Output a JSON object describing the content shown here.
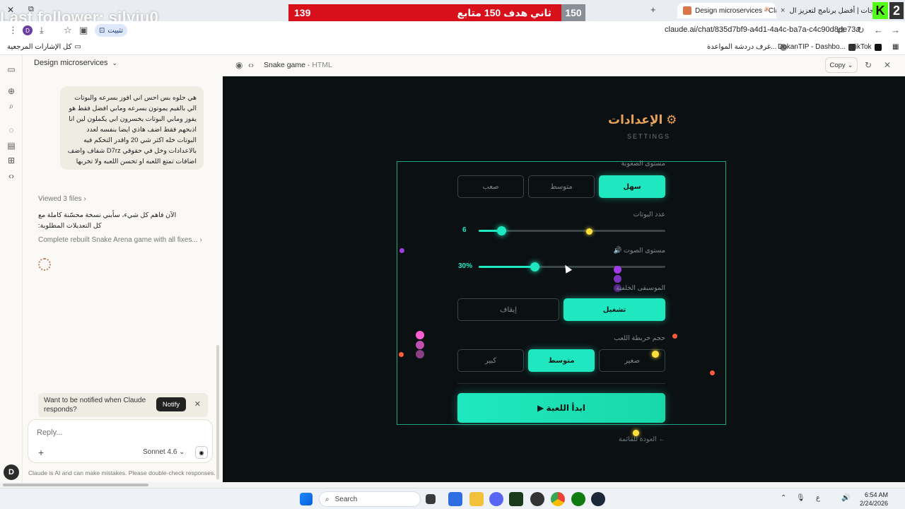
{
  "browser": {
    "tabs": [
      {
        "label": "Design microservices - Clau",
        "active": true
      },
      {
        "label": "الويدجات | أفضل برنامج لتعزيز ال",
        "active": false
      }
    ],
    "url": "claude.ai/chat/835d7bf9-a4d1-4a4c-ba7a-c4c90d8de73a",
    "install_label": "تثبيت",
    "profile_initial": "D",
    "bookmarks": {
      "all_bookmarks": "كل الإشارات المرجعية",
      "item_1": "غرف دردشة المواعدة...",
      "item_2": "DokanTIP - Dashbo...",
      "item_3": "TikTok"
    }
  },
  "overlay": {
    "follower_text": "Last follower: silviu0",
    "goal_current": "139",
    "goal_text": "ثاني هدف 150 متابع",
    "goal_target": "150",
    "kick_count": "2"
  },
  "claude": {
    "chat_title": "Design microservices",
    "user_message": "هي حلوه بس احس اني افوز بسرعه والبوتات الي بالقيم يموتون بسرعه ومابي افضل فقط هو يفوز ومابي البوتات يخسرون ابي يكملون لين انا اذبحهم فقط اضف هاذي ايضا بنفسه لعدد البوتات خله اكثر شي 20 واقدر التحكم فيه بالاعدادات وخل في حقوقي D7rz شفاف واضف اضافات تمتع اللعبه او تحسن اللعبه ولا تخربها",
    "viewed_files": "Viewed 3 files",
    "assistant_message": "الآن فاهم كل شيء، سأبني نسخة محسّنة كاملة مع كل التعديلات المطلوبة:",
    "artifact_link": "Complete rebuilt Snake Arena game with all fixes...",
    "notify_text": "Want to be notified when Claude responds?",
    "notify_button": "Notify",
    "reply_placeholder": "Reply...",
    "model": "Sonnet 4.6",
    "disclaimer": "Claude is AI and can make mistakes. Please double-check responses.",
    "user_initial": "D"
  },
  "artifact": {
    "title": "Snake game",
    "type": "HTML",
    "copy_label": "Copy"
  },
  "game": {
    "settings_title": "⚙ الإعدادات",
    "settings_subtitle": "SETTINGS",
    "difficulty": {
      "label": "مستوى الصعوبة",
      "options": [
        "سهل",
        "متوسط",
        "صعب"
      ],
      "selected": "سهل"
    },
    "bots": {
      "label": "عدد البوتات",
      "value": "6",
      "fraction": 0.12
    },
    "volume": {
      "label": "مستوى الصوت 🔊",
      "value": "30%",
      "fraction": 0.3
    },
    "music": {
      "label": "الموسيقى الخلفية",
      "options": [
        "تشغيل",
        "إيقاف"
      ],
      "selected": "تشغيل"
    },
    "map_size": {
      "label": "حجم خريطة اللعب",
      "options": [
        "صغير",
        "متوسط",
        "كبير"
      ],
      "selected": "متوسط"
    },
    "start_button": "ابدأ اللعبة ▶",
    "back_link": "← العودة للقائمة",
    "accent": "#1fe8c0"
  },
  "taskbar": {
    "search": "Search",
    "time": "6:54 AM",
    "date": "2/24/2026",
    "lang": "ع"
  }
}
